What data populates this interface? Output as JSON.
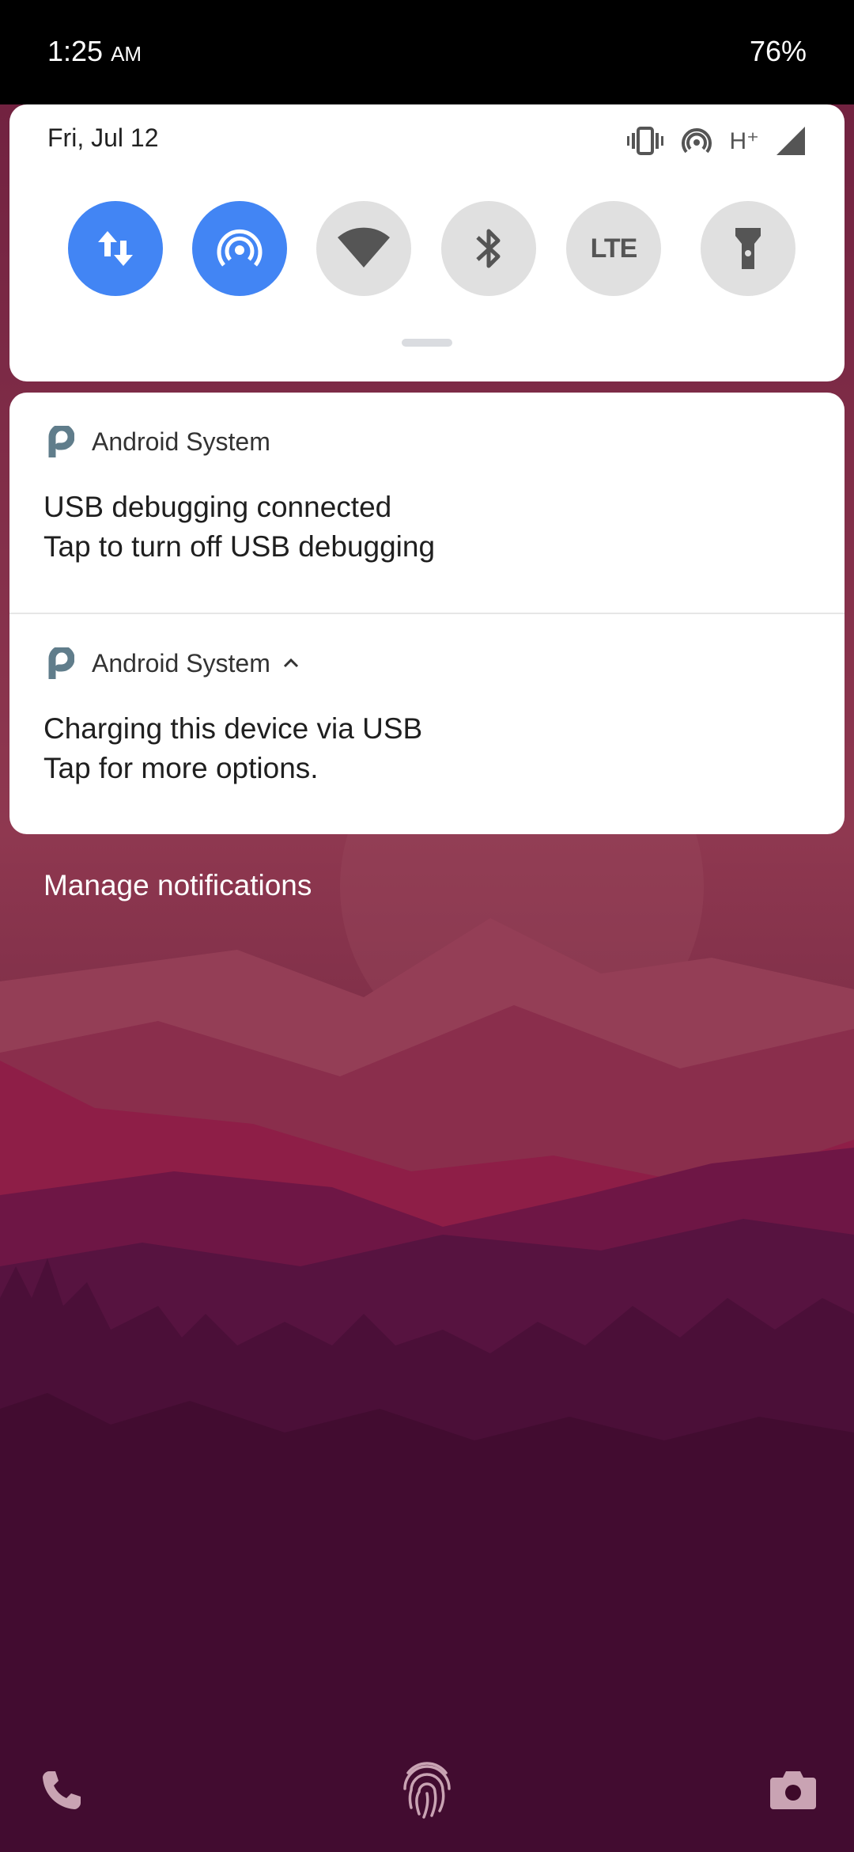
{
  "status_bar": {
    "time": "1:25",
    "ampm": "AM",
    "battery": "76%"
  },
  "quick_settings": {
    "date": "Fri, Jul 12",
    "network_type": "H⁺",
    "tiles": [
      {
        "name": "mobile-data",
        "on": true
      },
      {
        "name": "hotspot",
        "on": true
      },
      {
        "name": "wifi",
        "on": false
      },
      {
        "name": "bluetooth",
        "on": false
      },
      {
        "name": "lte",
        "label": "LTE",
        "on": false
      },
      {
        "name": "flashlight",
        "on": false
      }
    ]
  },
  "notifications": [
    {
      "app": "Android System",
      "title": "USB debugging connected",
      "text": "Tap to turn off USB debugging"
    },
    {
      "app": "Android System",
      "title": "Charging this device via USB",
      "text": "Tap for more options."
    }
  ],
  "manage_label": "Manage notifications",
  "colors": {
    "accent": "#4285f4",
    "app_icon": "#607d8b"
  }
}
